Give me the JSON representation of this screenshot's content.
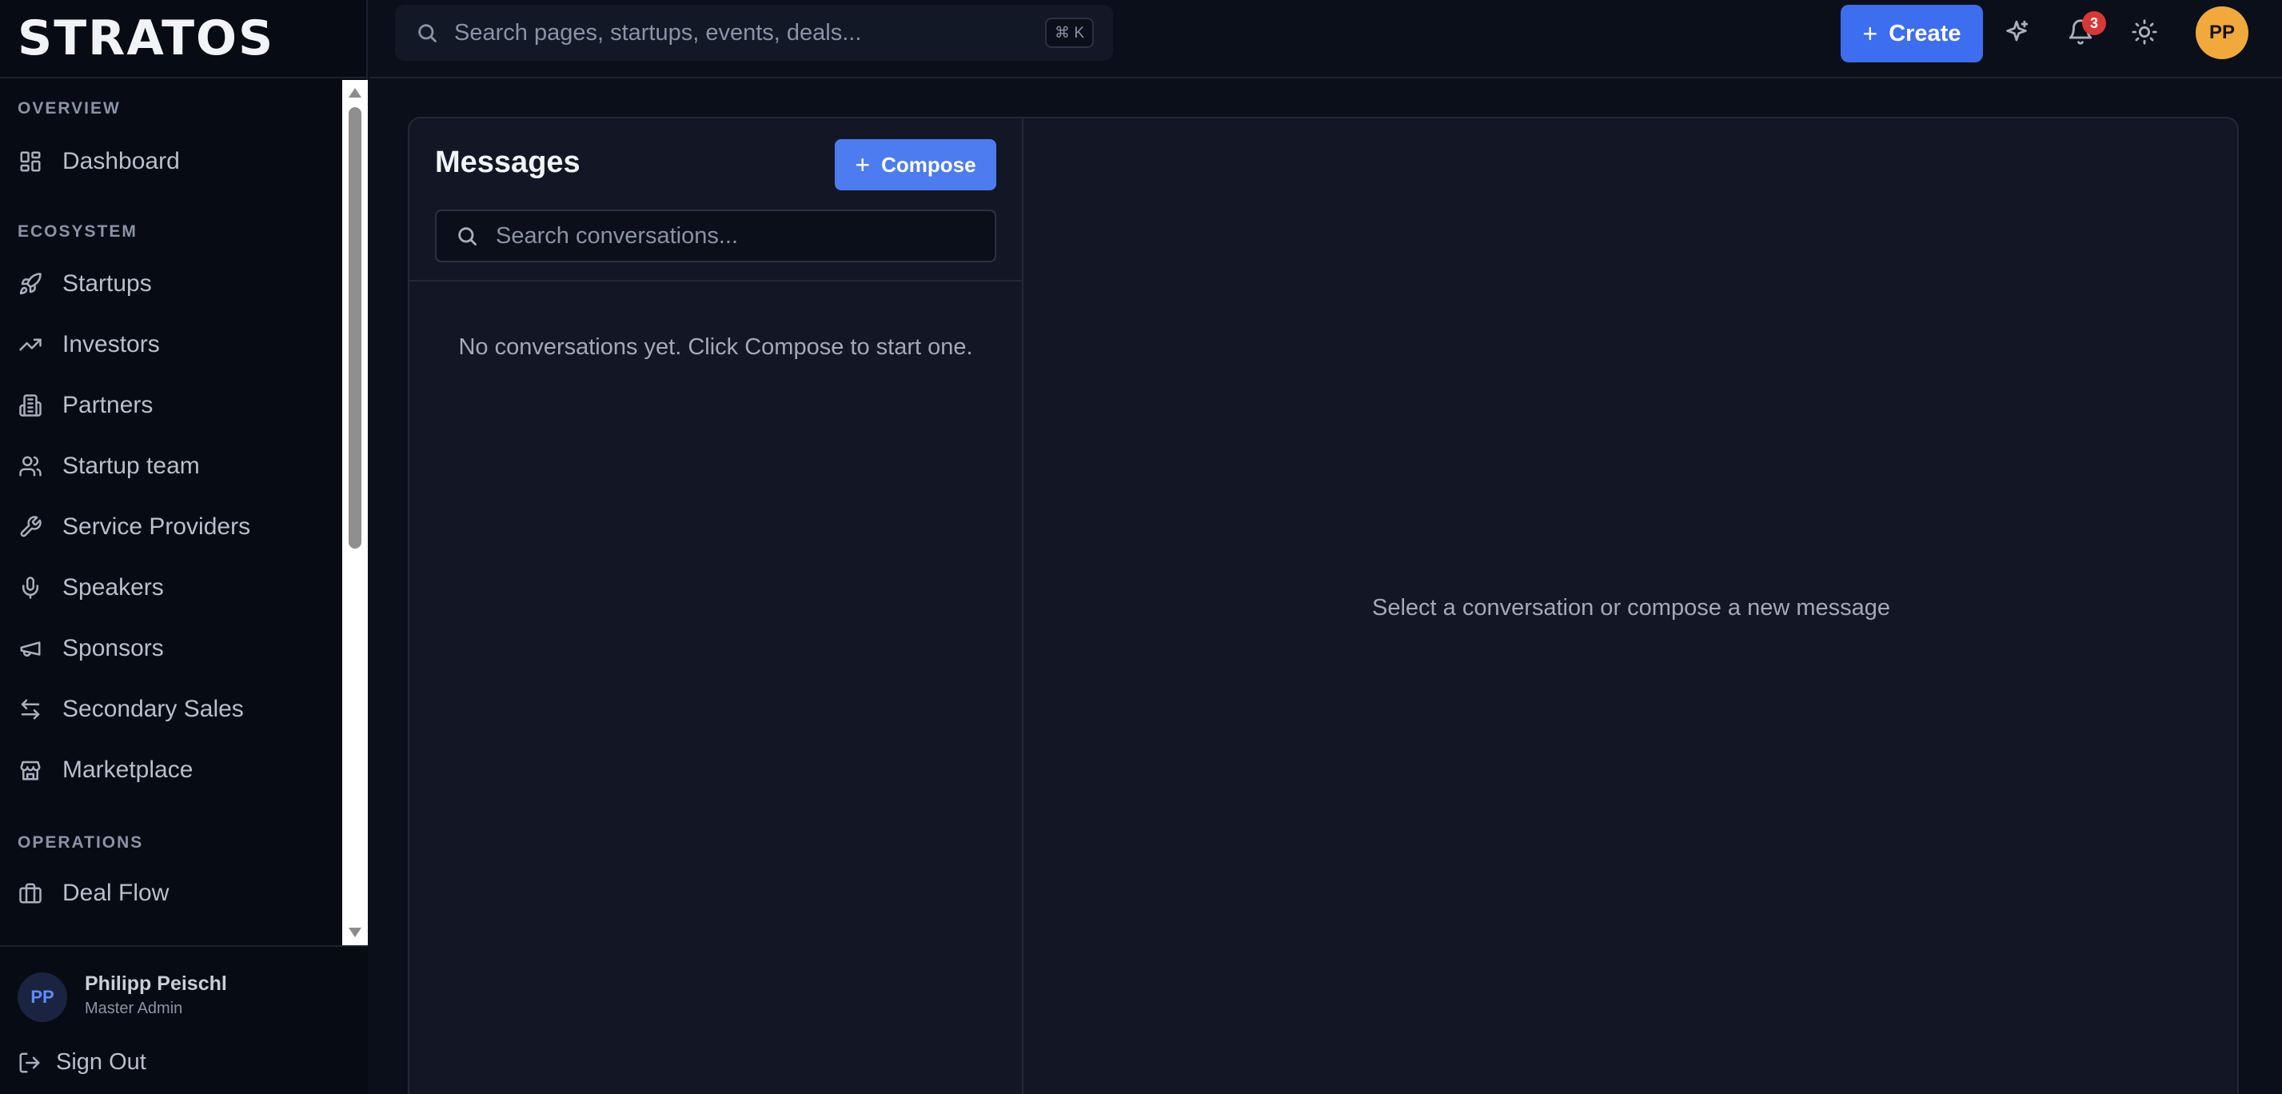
{
  "app": {
    "logo": "STRATOS"
  },
  "sidebar": {
    "sections": [
      {
        "label": "OVERVIEW"
      },
      {
        "label": "ECOSYSTEM"
      },
      {
        "label": "OPERATIONS"
      }
    ],
    "items": [
      {
        "label": "Dashboard",
        "icon": "dashboard-icon"
      },
      {
        "label": "Startups",
        "icon": "rocket-icon"
      },
      {
        "label": "Investors",
        "icon": "trending-up-icon"
      },
      {
        "label": "Partners",
        "icon": "building-icon"
      },
      {
        "label": "Startup team",
        "icon": "users-icon"
      },
      {
        "label": "Service Providers",
        "icon": "wrench-icon"
      },
      {
        "label": "Speakers",
        "icon": "microphone-icon"
      },
      {
        "label": "Sponsors",
        "icon": "megaphone-icon"
      },
      {
        "label": "Secondary Sales",
        "icon": "arrows-exchange-icon"
      },
      {
        "label": "Marketplace",
        "icon": "store-icon"
      },
      {
        "label": "Deal Flow",
        "icon": "briefcase-icon"
      }
    ],
    "user": {
      "initials": "PP",
      "name": "Philipp Peischl",
      "role": "Master Admin"
    },
    "signout_label": "Sign Out"
  },
  "topbar": {
    "search_placeholder": "Search pages, startups, events, deals...",
    "shortcut": "⌘ K",
    "create_label": "Create",
    "notification_count": "3",
    "avatar_initials": "PP"
  },
  "messages": {
    "title": "Messages",
    "compose_label": "Compose",
    "search_placeholder": "Search conversations...",
    "empty_list_text": "No conversations yet. Click Compose to start one.",
    "empty_detail_text": "Select a conversation or compose a new message"
  },
  "colors": {
    "accent": "#3d6ef0",
    "badge": "#d93636",
    "avatar": "#f0a93a",
    "background": "#0b0f19"
  }
}
